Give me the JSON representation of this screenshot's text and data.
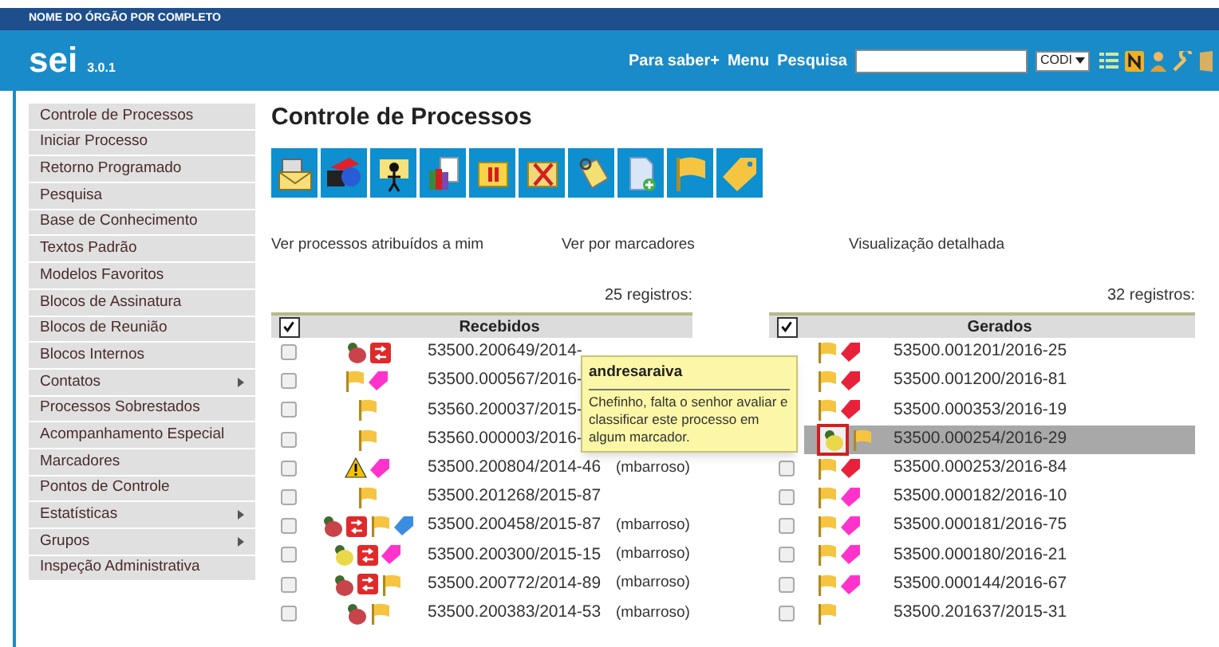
{
  "org_name": "NOME DO ÓRGÃO POR COMPLETO",
  "logo": {
    "name": "sei",
    "version": "3.0.1"
  },
  "header_links": [
    "Para saber+",
    "Menu",
    "Pesquisa"
  ],
  "search": {
    "scope": "CODI"
  },
  "header_icons": [
    {
      "kind": "list"
    },
    {
      "kind": "notes"
    },
    {
      "kind": "user"
    },
    {
      "kind": "wrench"
    },
    {
      "kind": "exit"
    }
  ],
  "sidebar": {
    "items": [
      {
        "label": "Controle de Processos",
        "has_submenu": false
      },
      {
        "label": "Iniciar Processo",
        "has_submenu": false
      },
      {
        "label": "Retorno Programado",
        "has_submenu": false
      },
      {
        "label": "Pesquisa",
        "has_submenu": false
      },
      {
        "label": "Base de Conhecimento",
        "has_submenu": false
      },
      {
        "label": "Textos Padrão",
        "has_submenu": false
      },
      {
        "label": "Modelos Favoritos",
        "has_submenu": false
      },
      {
        "label": "Blocos de Assinatura",
        "has_submenu": false
      },
      {
        "label": "Blocos de Reunião",
        "has_submenu": false
      },
      {
        "label": "Blocos Internos",
        "has_submenu": false
      },
      {
        "label": "Contatos",
        "has_submenu": true
      },
      {
        "label": "Processos Sobrestados",
        "has_submenu": false
      },
      {
        "label": "Acompanhamento Especial",
        "has_submenu": false
      },
      {
        "label": "Marcadores",
        "has_submenu": false
      },
      {
        "label": "Pontos de Controle",
        "has_submenu": false
      },
      {
        "label": "Estatísticas",
        "has_submenu": true
      },
      {
        "label": "Grupos",
        "has_submenu": true
      },
      {
        "label": "Inspeção Administrativa",
        "has_submenu": false
      }
    ]
  },
  "page_title": "Controle de Processos",
  "toolbar": [
    {
      "kind": "envelope"
    },
    {
      "kind": "globe"
    },
    {
      "kind": "person"
    },
    {
      "kind": "books"
    },
    {
      "kind": "pause"
    },
    {
      "kind": "folder-x"
    },
    {
      "kind": "clipboard"
    },
    {
      "kind": "document-plus"
    },
    {
      "kind": "flag"
    },
    {
      "kind": "tag"
    }
  ],
  "view_links": [
    "Ver processos atribuídos a mim",
    "Ver por marcadores",
    "Visualização detalhada"
  ],
  "tables": [
    {
      "count": "25 registros:",
      "title": "Recebidos",
      "header_checked": true,
      "rows": [
        {
          "has_checkbox": true,
          "checked": false,
          "selected": false,
          "icons": [
            {
              "kind": "annotation"
            },
            {
              "kind": "transfer"
            }
          ],
          "number": "53500.200649/2014-",
          "user": ""
        },
        {
          "has_checkbox": true,
          "checked": false,
          "selected": false,
          "icons": [
            {
              "kind": "flag"
            },
            {
              "kind": "tag",
              "color": "#ff33cc"
            }
          ],
          "number": "53500.000567/2016-",
          "user": ""
        },
        {
          "has_checkbox": true,
          "checked": false,
          "selected": false,
          "icons": [
            {
              "kind": "flag"
            }
          ],
          "number": "53560.200037/2015-",
          "user": ""
        },
        {
          "has_checkbox": true,
          "checked": false,
          "selected": false,
          "icons": [
            {
              "kind": "flag"
            }
          ],
          "number": "53560.000003/2016-",
          "user": ""
        },
        {
          "has_checkbox": true,
          "checked": false,
          "selected": false,
          "icons": [
            {
              "kind": "warning"
            },
            {
              "kind": "tag",
              "color": "#ff33cc"
            }
          ],
          "number": "53500.200804/2014-46",
          "user": "(mbarroso)"
        },
        {
          "has_checkbox": true,
          "checked": false,
          "selected": false,
          "icons": [
            {
              "kind": "flag"
            }
          ],
          "number": "53500.201268/2015-87",
          "user": ""
        },
        {
          "has_checkbox": true,
          "checked": false,
          "selected": false,
          "icons": [
            {
              "kind": "annotation"
            },
            {
              "kind": "transfer"
            },
            {
              "kind": "flag"
            },
            {
              "kind": "tag",
              "color": "#3a8de0"
            }
          ],
          "number": "53500.200458/2015-87",
          "user": "(mbarroso)"
        },
        {
          "has_checkbox": true,
          "checked": false,
          "selected": false,
          "icons": [
            {
              "kind": "note"
            },
            {
              "kind": "transfer"
            },
            {
              "kind": "tag",
              "color": "#ff33cc"
            }
          ],
          "number": "53500.200300/2015-15",
          "user": "(mbarroso)"
        },
        {
          "has_checkbox": true,
          "checked": false,
          "selected": false,
          "icons": [
            {
              "kind": "annotation"
            },
            {
              "kind": "transfer"
            },
            {
              "kind": "flag"
            }
          ],
          "number": "53500.200772/2014-89",
          "user": "(mbarroso)"
        },
        {
          "has_checkbox": true,
          "checked": false,
          "selected": false,
          "icons": [
            {
              "kind": "annotation"
            },
            {
              "kind": "flag"
            }
          ],
          "number": "53500.200383/2014-53",
          "user": "(mbarroso)"
        }
      ]
    },
    {
      "count": "32 registros:",
      "title": "Gerados",
      "header_checked": true,
      "rows": [
        {
          "has_checkbox": false,
          "selected": false,
          "icons": [
            {
              "kind": "flag"
            },
            {
              "kind": "tag",
              "color": "#e8213a"
            }
          ],
          "number": "53500.001201/2016-25",
          "user": ""
        },
        {
          "has_checkbox": false,
          "selected": false,
          "icons": [
            {
              "kind": "flag"
            },
            {
              "kind": "tag",
              "color": "#e8213a"
            }
          ],
          "number": "53500.001200/2016-81",
          "user": ""
        },
        {
          "has_checkbox": false,
          "selected": false,
          "icons": [
            {
              "kind": "flag"
            },
            {
              "kind": "tag",
              "color": "#e8213a"
            }
          ],
          "number": "53500.000353/2016-19",
          "user": ""
        },
        {
          "has_checkbox": false,
          "selected": true,
          "icons": [
            {
              "kind": "note-framed"
            },
            {
              "kind": "flag"
            }
          ],
          "number": "53500.000254/2016-29",
          "user": ""
        },
        {
          "has_checkbox": true,
          "checked": false,
          "selected": false,
          "icons": [
            {
              "kind": "flag"
            },
            {
              "kind": "tag",
              "color": "#e8213a"
            }
          ],
          "number": "53500.000253/2016-84",
          "user": ""
        },
        {
          "has_checkbox": true,
          "checked": false,
          "selected": false,
          "icons": [
            {
              "kind": "flag"
            },
            {
              "kind": "tag",
              "color": "#ff33cc"
            }
          ],
          "number": "53500.000182/2016-10",
          "user": ""
        },
        {
          "has_checkbox": true,
          "checked": false,
          "selected": false,
          "icons": [
            {
              "kind": "flag"
            },
            {
              "kind": "tag",
              "color": "#ff33cc"
            }
          ],
          "number": "53500.000181/2016-75",
          "user": ""
        },
        {
          "has_checkbox": true,
          "checked": false,
          "selected": false,
          "icons": [
            {
              "kind": "flag"
            },
            {
              "kind": "tag",
              "color": "#ff33cc"
            }
          ],
          "number": "53500.000180/2016-21",
          "user": ""
        },
        {
          "has_checkbox": true,
          "checked": false,
          "selected": false,
          "icons": [
            {
              "kind": "flag"
            },
            {
              "kind": "tag",
              "color": "#ff33cc"
            }
          ],
          "number": "53500.000144/2016-67",
          "user": ""
        },
        {
          "has_checkbox": true,
          "checked": false,
          "selected": false,
          "icons": [
            {
              "kind": "flag"
            }
          ],
          "number": "53500.201637/2015-31",
          "user": ""
        }
      ]
    }
  ],
  "tooltip": {
    "author": "andresaraiva",
    "text": "Chefinho, falta o senhor avaliar e classificar este processo em algum marcador."
  }
}
